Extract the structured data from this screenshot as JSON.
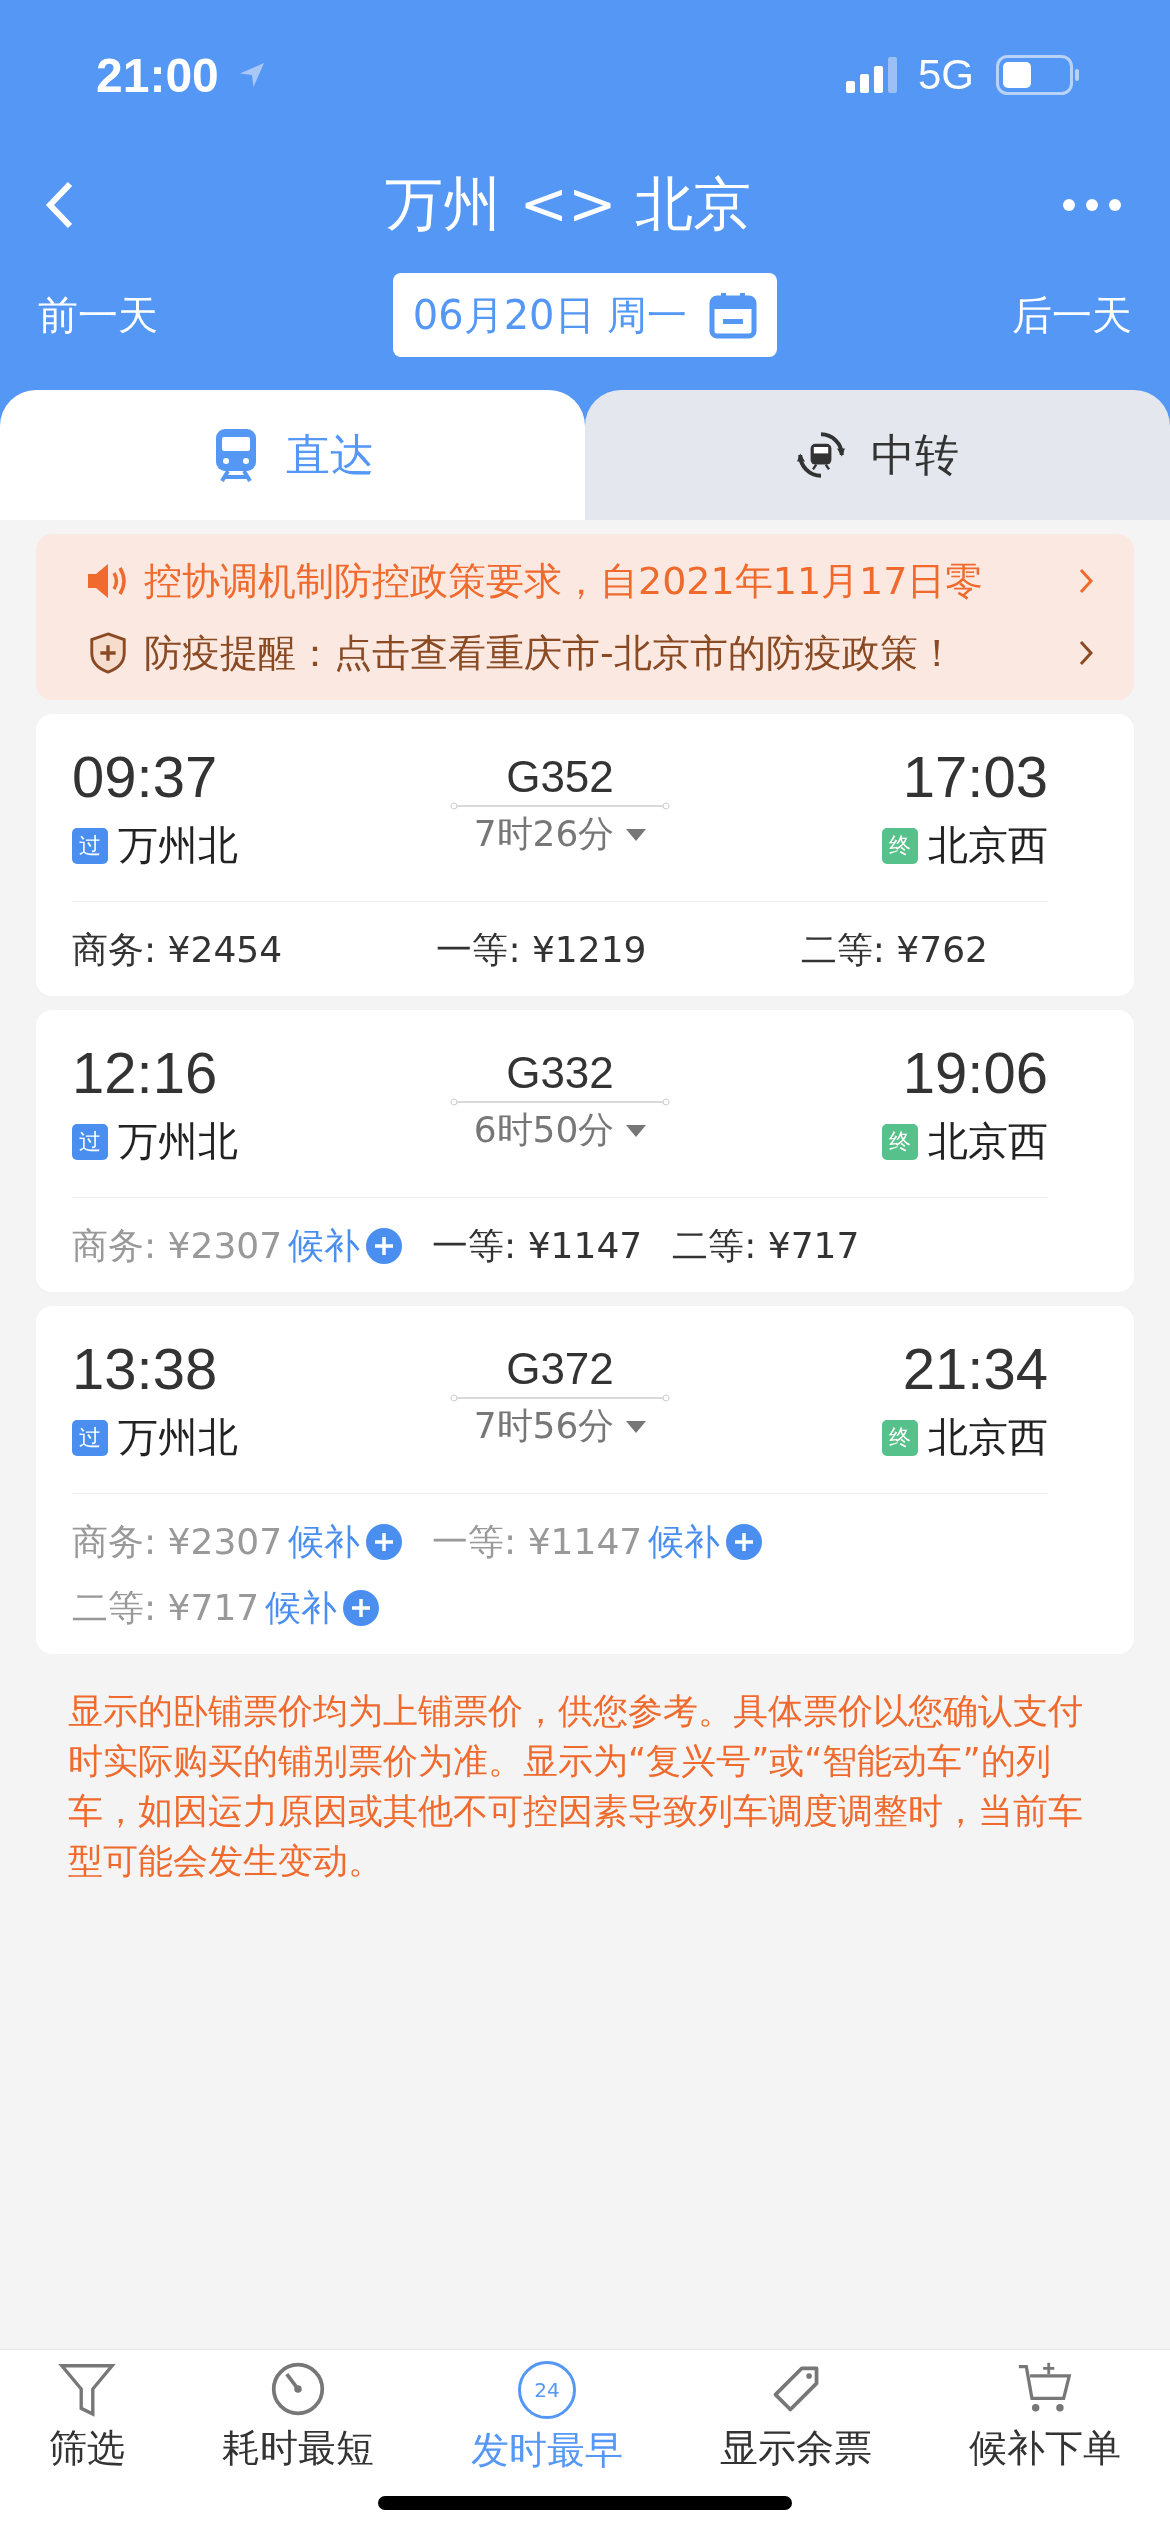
{
  "status_bar": {
    "time": "21:00",
    "network": "5G"
  },
  "nav": {
    "title": "万州 <> 北京",
    "prev_day": "前一天",
    "date": "06月20日 周一",
    "next_day": "后一天"
  },
  "tabs": [
    {
      "label": "直达",
      "selected": true
    },
    {
      "label": "中转",
      "selected": false
    }
  ],
  "notices": [
    {
      "kind": "policy",
      "text": "控协调机制防控政策要求，自2021年11月17日零"
    },
    {
      "kind": "epidemic",
      "text": "防疫提醒：点击查看重庆市-北京市的防疫政策！"
    }
  ],
  "trains": [
    {
      "depart": "09:37",
      "train": "G352",
      "duration": "7时26分",
      "arrive": "17:03",
      "from_tag": "过",
      "from": "万州北",
      "to_tag": "终",
      "to": "北京西",
      "seats": [
        {
          "label": "商务: ¥2454",
          "available": true
        },
        {
          "label": "一等: ¥1219",
          "available": true
        },
        {
          "label": "二等: ¥762",
          "available": true
        }
      ]
    },
    {
      "depart": "12:16",
      "train": "G332",
      "duration": "6时50分",
      "arrive": "19:06",
      "from_tag": "过",
      "from": "万州北",
      "to_tag": "终",
      "to": "北京西",
      "seats": [
        {
          "label": "商务: ¥2307",
          "available": false,
          "waitlist": "候补"
        },
        {
          "label": "一等: ¥1147",
          "available": true
        },
        {
          "label": "二等: ¥717",
          "available": true
        }
      ]
    },
    {
      "depart": "13:38",
      "train": "G372",
      "duration": "7时56分",
      "arrive": "21:34",
      "from_tag": "过",
      "from": "万州北",
      "to_tag": "终",
      "to": "北京西",
      "seats": [
        {
          "label": "商务: ¥2307",
          "available": false,
          "waitlist": "候补"
        },
        {
          "label": "一等: ¥1147",
          "available": false,
          "waitlist": "候补"
        },
        {
          "label": "二等: ¥717",
          "available": false,
          "waitlist": "候补"
        }
      ]
    }
  ],
  "footnote": "显示的卧铺票价均为上铺票价，供您参考。具体票价以您确认支付时实际购买的铺别票价为准。显示为“复兴号”或“智能动车”的列车，如因运力原因或其他不可控因素导致列车调度调整时，当前车型可能会发生变动。",
  "bottom_bar": [
    {
      "kind": "filter",
      "label": "筛选",
      "selected": false
    },
    {
      "kind": "duration",
      "label": "耗时最短",
      "selected": false
    },
    {
      "kind": "earliest",
      "label": "发时最早",
      "icon_text": "24",
      "selected": true
    },
    {
      "kind": "remaining",
      "label": "显示余票",
      "selected": false
    },
    {
      "kind": "waitlist",
      "label": "候补下单",
      "selected": false
    }
  ]
}
